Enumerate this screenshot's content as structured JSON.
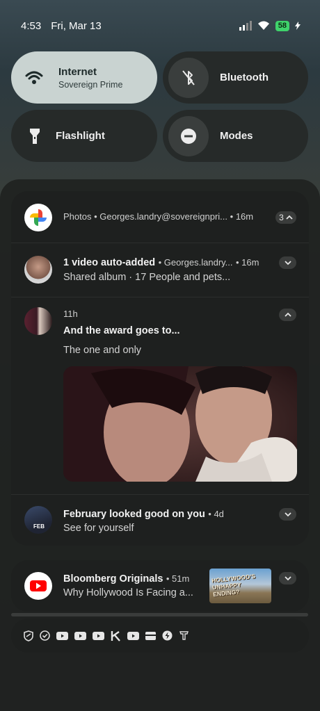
{
  "status": {
    "time": "4:53",
    "date": "Fri, Mar 13",
    "battery": "58"
  },
  "tiles": {
    "internet": {
      "title": "Internet",
      "subtitle": "Sovereign Prime",
      "icon": "wifi-icon"
    },
    "bluetooth": {
      "title": "Bluetooth",
      "icon": "bluetooth-off-icon"
    },
    "flashlight": {
      "title": "Flashlight",
      "icon": "flashlight-icon"
    },
    "modes": {
      "title": "Modes",
      "icon": "modes-icon"
    }
  },
  "photos_group": {
    "header": {
      "app": "Photos",
      "account": "Georges.landry@sovereignpri...",
      "time": "16m",
      "count": "3"
    },
    "notif1": {
      "title": "1 video auto-added",
      "sender": "Georges.landry...",
      "time": "16m",
      "body": "Shared album · 17 People and pets..."
    },
    "notif2": {
      "time": "11h",
      "title": "And the award goes to...",
      "body": "The one and only"
    },
    "notif3": {
      "title": "February looked good on you",
      "time": "4d",
      "body": "See for yourself",
      "thumb_label": "FEB"
    }
  },
  "youtube_notif": {
    "title": "Bloomberg Originals",
    "time": "51m",
    "body": "Why Hollywood Is Facing a...",
    "thumb_text": "HOLLYWOOD'S UNHAPPY ENDING?"
  },
  "overflow_icons": [
    "shield-icon",
    "check-circle-icon",
    "youtube-icon",
    "youtube-icon",
    "youtube-icon",
    "app-k-icon",
    "youtube-icon",
    "card-icon",
    "bolt-icon",
    "temu-icon"
  ],
  "colors": {
    "internet_tile": "#c9d3d1",
    "battery": "#3fd36b",
    "youtube_red": "#ff0000"
  }
}
